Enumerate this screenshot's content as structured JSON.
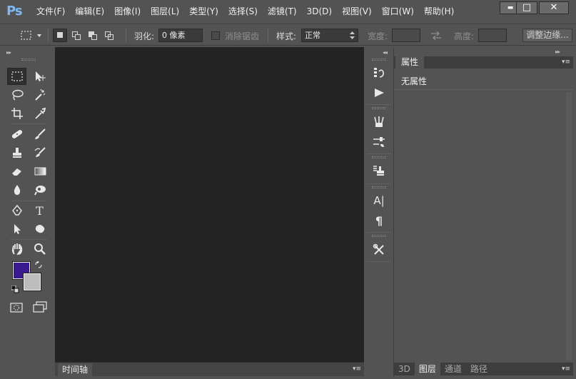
{
  "app": {
    "logo": "Ps"
  },
  "menu": [
    "文件(F)",
    "编辑(E)",
    "图像(I)",
    "图层(L)",
    "类型(Y)",
    "选择(S)",
    "滤镜(T)",
    "3D(D)",
    "视图(V)",
    "窗口(W)",
    "帮助(H)"
  ],
  "window": {
    "minimize": "▬",
    "maximize": "□",
    "close": "✕"
  },
  "options": {
    "feather_label": "羽化:",
    "feather_value": "0 像素",
    "antialias_label": "消除锯齿",
    "style_label": "样式:",
    "style_value": "正常",
    "width_label": "宽度:",
    "height_label": "高度:",
    "refine_edge": "调整边缘..."
  },
  "panels": {
    "collapse": "◂◂",
    "expand": "▸▸",
    "timeline_tab": "时间轴",
    "properties_tab": "属性",
    "properties_empty": "无属性",
    "menu_glyph": "▾≡",
    "bottom_tabs": [
      "3D",
      "图层",
      "通道",
      "路径"
    ]
  },
  "tools_panel": {
    "type_tool_glyph": "T"
  },
  "strip": {
    "character_glyph": "A|",
    "paragraph_glyph": "¶"
  },
  "colors": {
    "foreground": "#3a1a8f",
    "background": "#bdbdbd",
    "ui_bg": "#535353",
    "canvas": "#232323"
  }
}
